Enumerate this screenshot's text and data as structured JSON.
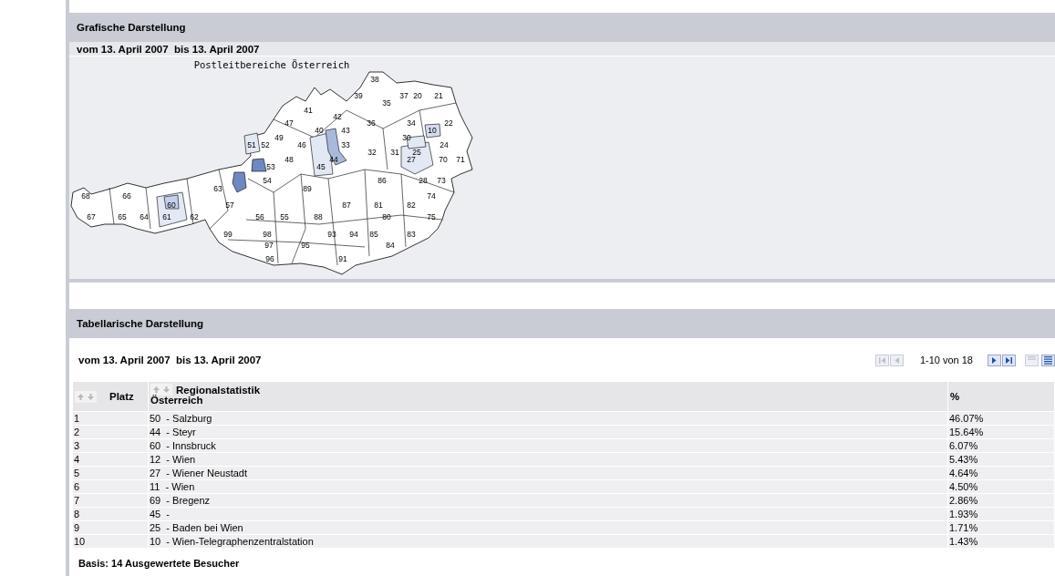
{
  "map_panel": {
    "title": "Grafische Darstellung",
    "date_range": "vom 13. April 2007  bis 13. April 2007",
    "map": {
      "title": "Postleitbereiche  Österreich",
      "regions": [
        {
          "label": "38"
        },
        {
          "label": "39"
        },
        {
          "label": "37"
        },
        {
          "label": "20"
        },
        {
          "label": "21"
        },
        {
          "label": "35"
        },
        {
          "label": "41"
        },
        {
          "label": "42"
        },
        {
          "label": "47"
        },
        {
          "label": "36"
        },
        {
          "label": "34"
        },
        {
          "label": "22"
        },
        {
          "label": "40"
        },
        {
          "label": "43"
        },
        {
          "label": "10"
        },
        {
          "label": "49"
        },
        {
          "label": "30"
        },
        {
          "label": "51"
        },
        {
          "label": "52"
        },
        {
          "label": "46"
        },
        {
          "label": "33"
        },
        {
          "label": "24"
        },
        {
          "label": "32"
        },
        {
          "label": "31"
        },
        {
          "label": "25"
        },
        {
          "label": "48"
        },
        {
          "label": "44"
        },
        {
          "label": "27"
        },
        {
          "label": "70"
        },
        {
          "label": "71"
        },
        {
          "label": "53"
        },
        {
          "label": "45"
        },
        {
          "label": "54"
        },
        {
          "label": "86"
        },
        {
          "label": "28"
        },
        {
          "label": "73"
        },
        {
          "label": "63"
        },
        {
          "label": "89"
        },
        {
          "label": "68"
        },
        {
          "label": "66"
        },
        {
          "label": "74"
        },
        {
          "label": "60"
        },
        {
          "label": "57"
        },
        {
          "label": "87"
        },
        {
          "label": "81"
        },
        {
          "label": "82"
        },
        {
          "label": "67"
        },
        {
          "label": "65"
        },
        {
          "label": "64"
        },
        {
          "label": "61"
        },
        {
          "label": "62"
        },
        {
          "label": "56"
        },
        {
          "label": "55"
        },
        {
          "label": "88"
        },
        {
          "label": "80"
        },
        {
          "label": "75"
        },
        {
          "label": "99"
        },
        {
          "label": "98"
        },
        {
          "label": "93"
        },
        {
          "label": "94"
        },
        {
          "label": "85"
        },
        {
          "label": "83"
        },
        {
          "label": "97"
        },
        {
          "label": "95"
        },
        {
          "label": "84"
        },
        {
          "label": "96"
        },
        {
          "label": "91"
        }
      ]
    }
  },
  "table_panel": {
    "title": "Tabellarische Darstellung",
    "date_range": "vom 13. April 2007  bis 13. April 2007",
    "pager": {
      "range": "1-10 von 18",
      "buttons": [
        {
          "kind": "first",
          "disabled": true
        },
        {
          "kind": "prev",
          "disabled": true
        },
        {
          "kind": "next",
          "disabled": false
        },
        {
          "kind": "last",
          "disabled": false
        }
      ],
      "page_sizes": [
        {
          "kind": "ten",
          "selected": false
        },
        {
          "kind": "twenty",
          "selected": true
        }
      ]
    },
    "columns": [
      {
        "label": "Platz",
        "sortable": true
      },
      {
        "label": "Regionalstatistik",
        "sublabel": "Österreich",
        "sortable": true
      },
      {
        "label": "%",
        "sortable": false
      }
    ],
    "rows": [
      {
        "rank": "1",
        "region": "50  - Salzburg",
        "percent": "46.07%"
      },
      {
        "rank": "2",
        "region": "44  - Steyr",
        "percent": "15.64%"
      },
      {
        "rank": "3",
        "region": "60  - Innsbruck",
        "percent": "6.07%"
      },
      {
        "rank": "4",
        "region": "12  - Wien",
        "percent": "5.43%"
      },
      {
        "rank": "5",
        "region": "27  - Wiener Neustadt",
        "percent": "4.64%"
      },
      {
        "rank": "6",
        "region": "11  - Wien",
        "percent": "4.50%"
      },
      {
        "rank": "7",
        "region": "69  - Bregenz",
        "percent": "2.86%"
      },
      {
        "rank": "8",
        "region": "45  -",
        "percent": "1.93%"
      },
      {
        "rank": "9",
        "region": "25  - Baden bei Wien",
        "percent": "1.71%"
      },
      {
        "rank": "10",
        "region": "10  - Wien-Telegraphenzentralstation",
        "percent": "1.43%"
      }
    ],
    "footer": "Basis: 14 Ausgewertete Besucher"
  }
}
